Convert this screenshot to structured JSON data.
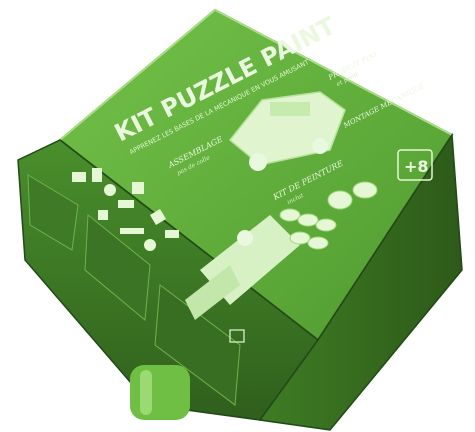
{
  "photo": {
    "subject": "product-box",
    "colors": {
      "background": "#ffffff",
      "tint": "#7bd34a",
      "lid_top": "#5fae3a",
      "lid_side": "#3f7f24",
      "lid_front": "#4e9830",
      "base_side": "#2f5f1c",
      "highlight": "#e6f7d6",
      "text_light": "#eaf8df"
    },
    "box": {
      "title": "KIT PUZZLE PAINT",
      "subtitle": "APPRENEZ LES BASES DE LA MÉCANIQUE EN VOUS AMUSANT",
      "age": "+8",
      "labels": {
        "assemblage": "ASSEMBLAGE",
        "assemblage_note": "pas de colle",
        "kit_peinture": "KIT DE PEINTURE",
        "kit_peinture_note": "inclut",
        "produit_fini": "PRODUIT FINI",
        "produit_fini_note": "et peint",
        "montage": "MONTAGE MÉCANIQUE"
      }
    }
  }
}
